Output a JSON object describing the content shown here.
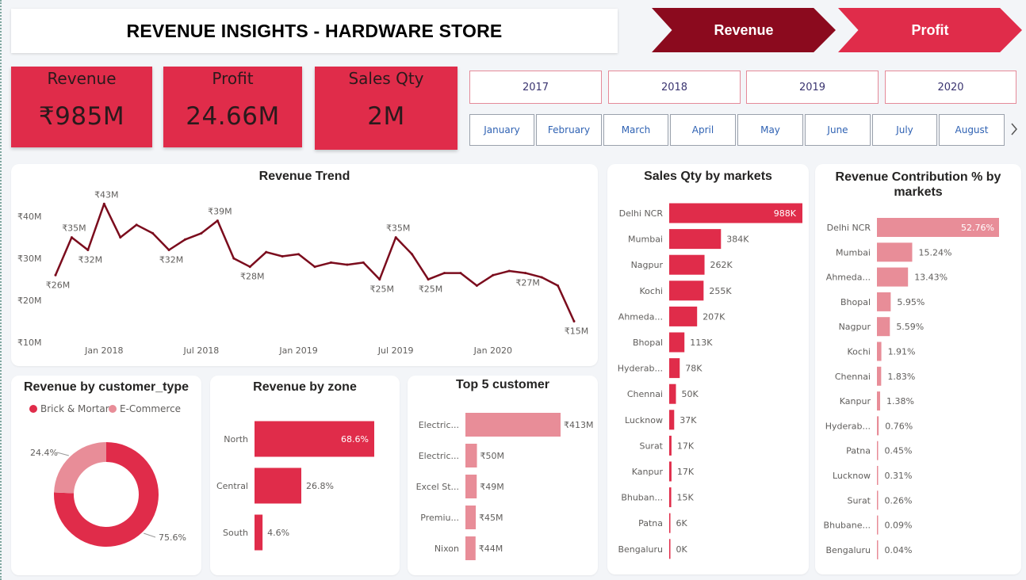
{
  "header": {
    "title": "REVENUE INSIGHTS - HARDWARE STORE"
  },
  "nav": {
    "revenue_label": "Revenue",
    "profit_label": "Profit"
  },
  "kpis": [
    {
      "label": "Revenue",
      "value": "₹985M"
    },
    {
      "label": "Profit",
      "value": "24.66M"
    },
    {
      "label": "Sales Qty",
      "value": "2M"
    }
  ],
  "years": [
    "2017",
    "2018",
    "2019",
    "2020"
  ],
  "months": [
    "January",
    "February",
    "March",
    "April",
    "May",
    "June",
    "July",
    "August"
  ],
  "month_scroll_icon": "chevron-right-icon",
  "colors": {
    "accent": "#e02c4a",
    "dark_red": "#8b0a1e",
    "light_red": "#e88d98",
    "line": "#7b0c1d"
  },
  "chart_data": [
    {
      "id": "revenue_trend",
      "type": "line",
      "title": "Revenue Trend",
      "x": [
        "2017-10",
        "2017-11",
        "2017-12",
        "2018-01",
        "2018-02",
        "2018-03",
        "2018-04",
        "2018-05",
        "2018-06",
        "2018-07",
        "2018-08",
        "2018-09",
        "2018-10",
        "2018-11",
        "2018-12",
        "2019-01",
        "2019-02",
        "2019-03",
        "2019-04",
        "2019-05",
        "2019-06",
        "2019-07",
        "2019-08",
        "2019-09",
        "2019-10",
        "2019-11",
        "2019-12",
        "2020-01",
        "2020-02",
        "2020-03",
        "2020-04",
        "2020-05",
        "2020-06"
      ],
      "values": [
        26,
        35,
        32,
        43,
        35,
        38,
        36,
        32,
        34.5,
        36,
        39,
        30,
        28,
        31.5,
        30.5,
        31,
        28,
        29,
        28.5,
        29,
        25,
        35,
        31,
        25,
        26.5,
        26.5,
        23.5,
        26,
        27,
        26.5,
        25.5,
        23.5,
        15
      ],
      "value_labels": [
        {
          "x": "2017-10",
          "label": "₹26M"
        },
        {
          "x": "2017-11",
          "label": "₹35M"
        },
        {
          "x": "2017-12",
          "label": "₹32M"
        },
        {
          "x": "2018-01",
          "label": "₹43M"
        },
        {
          "x": "2018-05",
          "label": "₹32M"
        },
        {
          "x": "2018-08",
          "label": "₹39M"
        },
        {
          "x": "2018-10",
          "label": "₹28M"
        },
        {
          "x": "2019-06",
          "label": "₹25M"
        },
        {
          "x": "2019-07",
          "label": "₹35M"
        },
        {
          "x": "2019-09",
          "label": "₹25M"
        },
        {
          "x": "2020-03",
          "label": "₹27M"
        },
        {
          "x": "2020-06",
          "label": "₹15M"
        }
      ],
      "y_ticks": [
        "₹10M",
        "₹20M",
        "₹30M",
        "₹40M"
      ],
      "y_tick_values": [
        10,
        20,
        30,
        40
      ],
      "x_ticks": [
        {
          "x": "2018-01",
          "label": "Jan 2018"
        },
        {
          "x": "2018-07",
          "label": "Jul 2018"
        },
        {
          "x": "2019-01",
          "label": "Jan 2019"
        },
        {
          "x": "2019-07",
          "label": "Jul 2019"
        },
        {
          "x": "2020-01",
          "label": "Jan 2020"
        }
      ],
      "ylim": [
        10,
        44
      ],
      "grid": false
    },
    {
      "id": "customer_type",
      "type": "pie",
      "title": "Revenue by customer_type",
      "series": [
        {
          "name": "Brick & Mortar",
          "value": 75.6,
          "label": "75.6%"
        },
        {
          "name": "E-Commerce",
          "value": 24.4,
          "label": "24.4%"
        }
      ],
      "legend": "top"
    },
    {
      "id": "zone",
      "type": "bar",
      "orientation": "horizontal",
      "title": "Revenue by zone",
      "categories": [
        "North",
        "Central",
        "South"
      ],
      "values": [
        68.6,
        26.8,
        4.6
      ],
      "labels": [
        "68.6%",
        "26.8%",
        "4.6%"
      ]
    },
    {
      "id": "top_customers",
      "type": "bar",
      "orientation": "horizontal",
      "title": "Top 5 customer",
      "categories": [
        "Electric...",
        "Electric...",
        "Excel St...",
        "Premiu...",
        "Nixon"
      ],
      "values": [
        413,
        50,
        49,
        45,
        44
      ],
      "labels": [
        "₹413M",
        "₹50M",
        "₹49M",
        "₹45M",
        "₹44M"
      ]
    },
    {
      "id": "sales_qty_markets",
      "type": "bar",
      "orientation": "horizontal",
      "title": "Sales Qty by markets",
      "categories": [
        "Delhi NCR",
        "Mumbai",
        "Nagpur",
        "Kochi",
        "Ahmeda...",
        "Bhopal",
        "Hyderab...",
        "Chennai",
        "Lucknow",
        "Surat",
        "Kanpur",
        "Bhuban...",
        "Patna",
        "Bengaluru"
      ],
      "values": [
        988,
        384,
        262,
        255,
        207,
        113,
        78,
        50,
        37,
        17,
        17,
        15,
        6,
        0.5
      ],
      "labels": [
        "988K",
        "384K",
        "262K",
        "255K",
        "207K",
        "113K",
        "78K",
        "50K",
        "37K",
        "17K",
        "17K",
        "15K",
        "6K",
        "0K"
      ]
    },
    {
      "id": "revenue_contribution",
      "type": "bar",
      "orientation": "horizontal",
      "title": "Revenue Contribution % by markets",
      "categories": [
        "Delhi NCR",
        "Mumbai",
        "Ahmeda...",
        "Bhopal",
        "Nagpur",
        "Kochi",
        "Chennai",
        "Kanpur",
        "Hyderab...",
        "Patna",
        "Lucknow",
        "Surat",
        "Bhubane...",
        "Bengaluru"
      ],
      "values": [
        52.76,
        15.24,
        13.43,
        5.95,
        5.59,
        1.91,
        1.83,
        1.38,
        0.76,
        0.45,
        0.31,
        0.26,
        0.09,
        0.04
      ],
      "labels": [
        "52.76%",
        "15.24%",
        "13.43%",
        "5.95%",
        "5.59%",
        "1.91%",
        "1.83%",
        "1.38%",
        "0.76%",
        "0.45%",
        "0.31%",
        "0.26%",
        "0.09%",
        "0.04%"
      ]
    }
  ]
}
